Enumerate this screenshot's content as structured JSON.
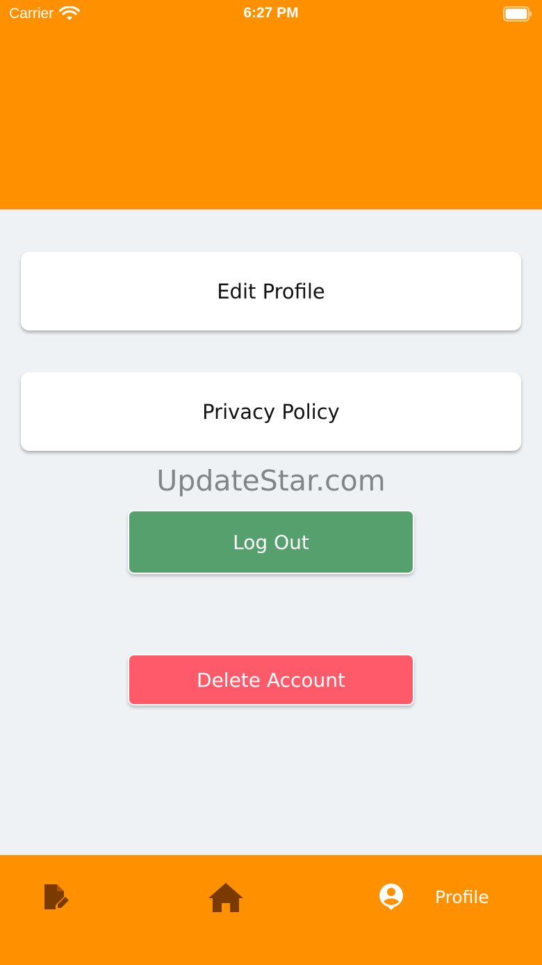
{
  "status_bar": {
    "carrier": "Carrier",
    "time": "6:27 PM",
    "wifi_icon": "wifi-icon",
    "battery_icon": "battery-icon"
  },
  "colors": {
    "header": "#ff9100",
    "background": "#eff2f5",
    "logout": "#56a06d",
    "delete": "#fe5a69",
    "nav_icon": "#7a3a00"
  },
  "menu": {
    "edit_profile": "Edit Profile",
    "privacy_policy": "Privacy Policy"
  },
  "watermark": "UpdateStar.com",
  "actions": {
    "logout": "Log Out",
    "delete_account": "Delete Account"
  },
  "bottom_nav": {
    "items": [
      {
        "icon": "document-edit-icon"
      },
      {
        "icon": "home-icon"
      },
      {
        "icon": "account-circle-icon",
        "label": "Profile"
      }
    ]
  }
}
